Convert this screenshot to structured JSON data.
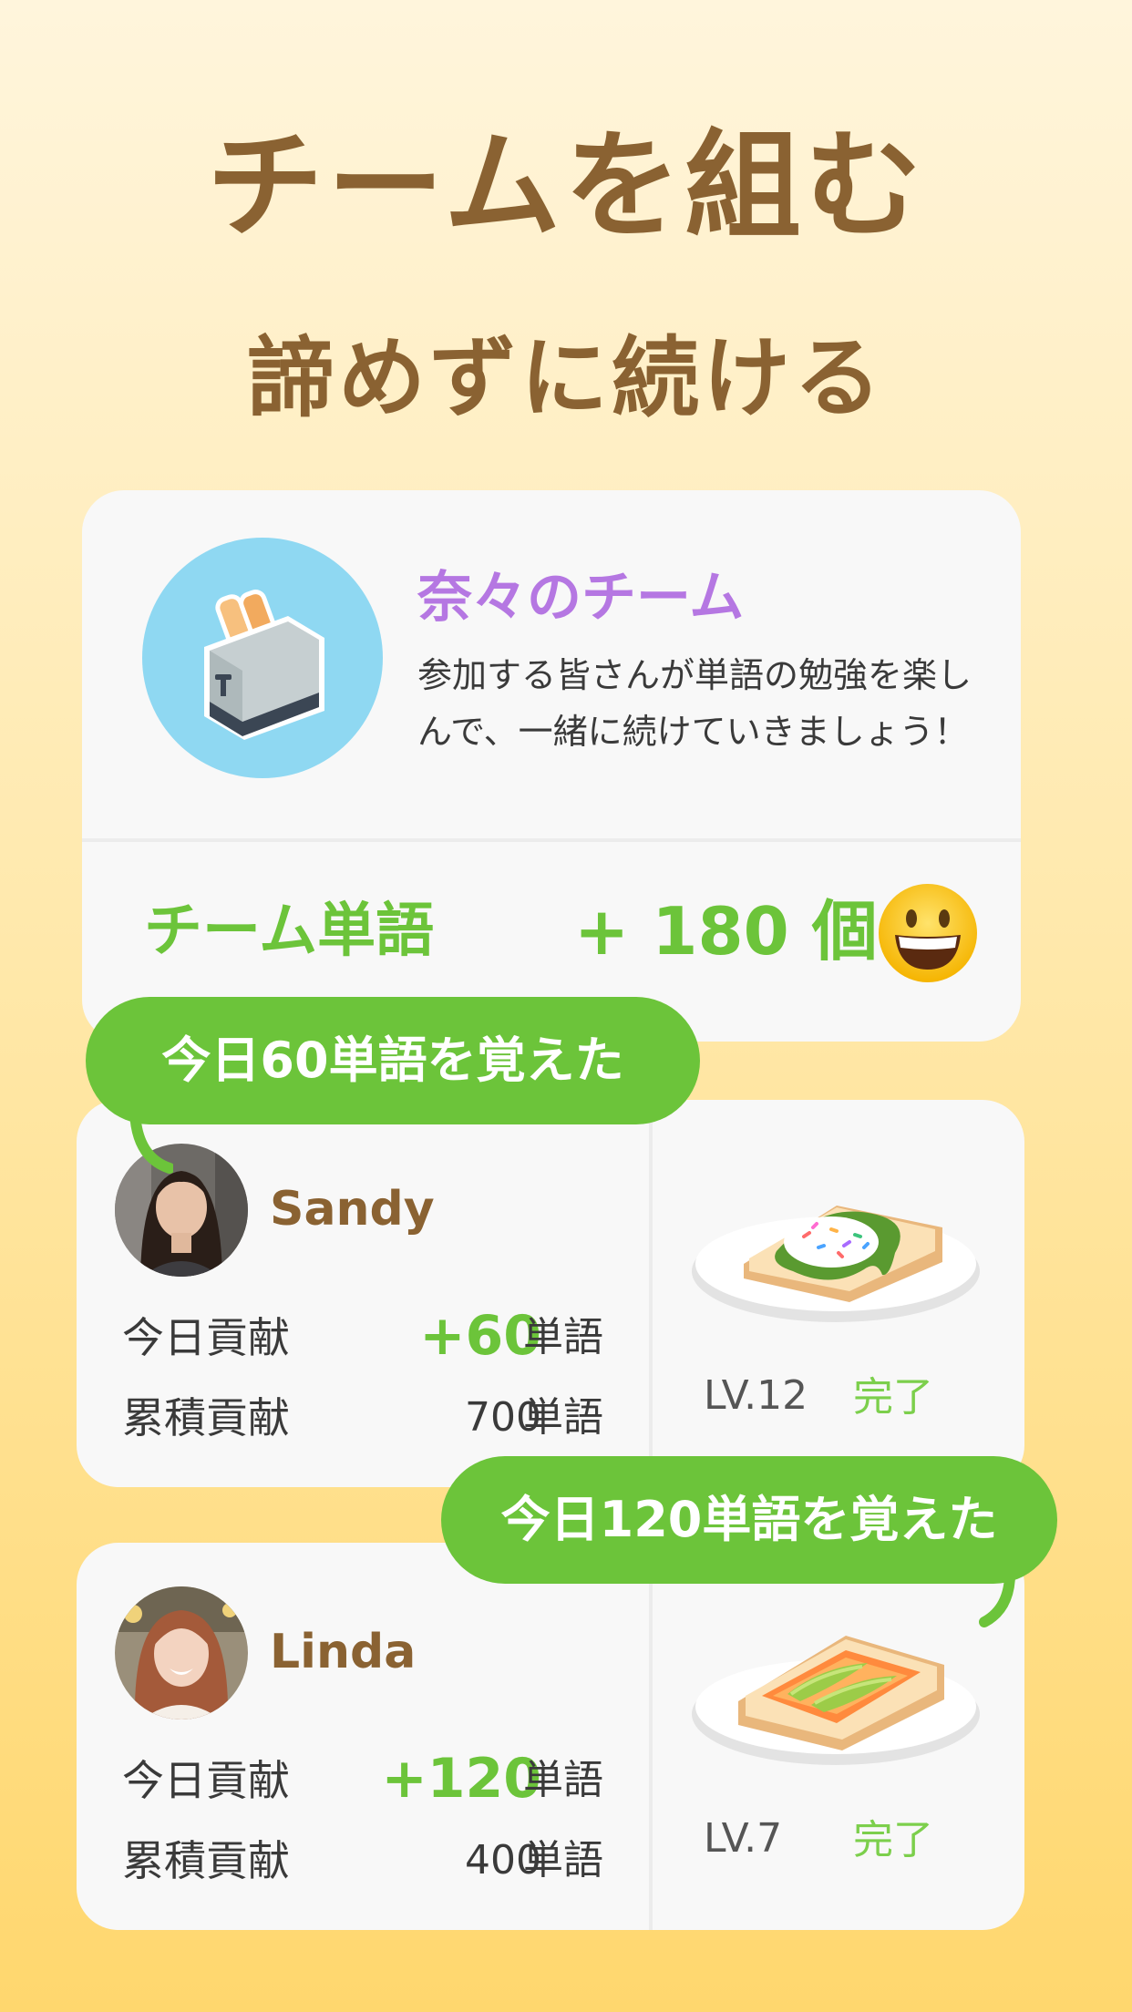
{
  "header": {
    "title": "チームを組む",
    "subtitle": "諦めずに続ける"
  },
  "team": {
    "name": "奈々のチーム",
    "description": "参加する皆さんが単語の勉強を楽しんで、一緒に続けていきましょう！",
    "avatar_icon": "toaster-icon",
    "words_label": "チーム単語",
    "words_value": "+ 180 個",
    "emoji": "grinning-face-icon"
  },
  "members": [
    {
      "bubble": "今日60単語を覚えた",
      "name": "Sandy",
      "today_label": "今日貢献",
      "today_value": "+60",
      "today_unit": "単語",
      "total_label": "累積貢献",
      "total_value": "700",
      "total_unit": "単語",
      "level": "LV.12",
      "status": "完了",
      "food_icon": "matcha-toast-icon"
    },
    {
      "bubble": "今日120単語を覚えた",
      "name": "Linda",
      "today_label": "今日貢献",
      "today_value": "+120",
      "today_unit": "単語",
      "total_label": "累積貢献",
      "total_value": "400",
      "total_unit": "単語",
      "level": "LV.7",
      "status": "完了",
      "food_icon": "avocado-salmon-toast-icon"
    }
  ],
  "colors": {
    "brown": "#8a6232",
    "green": "#6cc43a",
    "purple": "#b577e2",
    "card": "#f8f8f8"
  }
}
